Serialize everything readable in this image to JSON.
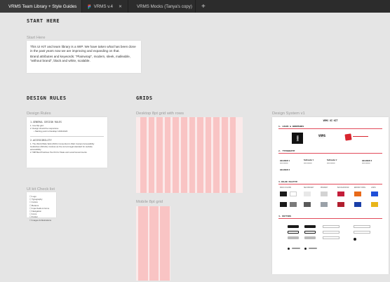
{
  "tabs": [
    {
      "label": "VRMS Team Library + Style Guides",
      "active": true
    },
    {
      "label": "VRMS v.4",
      "active": false
    },
    {
      "label": "VRMS Mocks (Tanya's copy)",
      "active": false
    }
  ],
  "canvas": {
    "start": {
      "heading": "START HERE",
      "label": "Start Here",
      "para1": "This UI KIT and team library is a WIP. We have taken what has been done in the past years now we are improving and expanding on that.",
      "para2": "Brand attributes and keywords: \"Plainwrap\", modern, sleek, malleable, \"without brand\", black and white, scalable."
    },
    "design_rules": {
      "heading": "DESIGN RULES",
      "label": "Design Rules",
      "section1": "1.GENERAL DESIGN RULES",
      "items1": [
        "Use 8pt grid",
        "Design should be responsive",
        "Starting point is Desktop 1440x1024"
      ],
      "section2": "2.ACCESSIBILITY",
      "items2": [
        "The World Wide Web (W3C) Consortium's Web Content Accessibility Guidelines (WCAG) involves as the current legal standard for website accessibility.",
        "508 Best Practices Tool Kit for State and Local Governments"
      ]
    },
    "checklist": {
      "label": "UI kit Check list",
      "items": [
        "Logo",
        "Typography",
        "Colors",
        "Buttons",
        "Input fields & forms",
        "Navigation",
        "Icons",
        "Footer",
        "Images & Illustrations"
      ]
    },
    "grids": {
      "heading": "GRIDS",
      "desktop_label": "Desktop 8pt grid with rows",
      "mobile_label": "Mobile 8pt grid"
    },
    "design_system": {
      "label": "Design System v1",
      "title": "VRMS UI KIT",
      "sections": [
        "1. LOGOS & WORDMARKS",
        "2. TYPOGRAPHY",
        "3.COLOR PALETTE",
        "4. BUTTONS"
      ],
      "logo_text": "VRMS",
      "headers": [
        "HEADER 1",
        "Subheader 1",
        "Subheader 2",
        "HEADER 3",
        "HEADER 2"
      ],
      "swatch_groups": [
        "MAIN COLORS",
        "SECONDARY",
        "PRIMARY",
        "BACKGROUND",
        "ERROR STATE",
        "LINKS"
      ],
      "swatches": [
        "#1b1b1b",
        "#ffffff",
        "#e8e8e8",
        "#d3d3d3",
        "#c41e3a",
        "#e86a1a",
        "#1b1b1b",
        "#7a7a7a",
        "#5a5a5a",
        "#9aa1a8",
        "#1f4fd8",
        "#e8b51a"
      ],
      "colors": {
        "accent_red": "#e34b5a",
        "grid_col": "#f9c4c4",
        "grid_bg": "#fbeaea"
      }
    }
  }
}
